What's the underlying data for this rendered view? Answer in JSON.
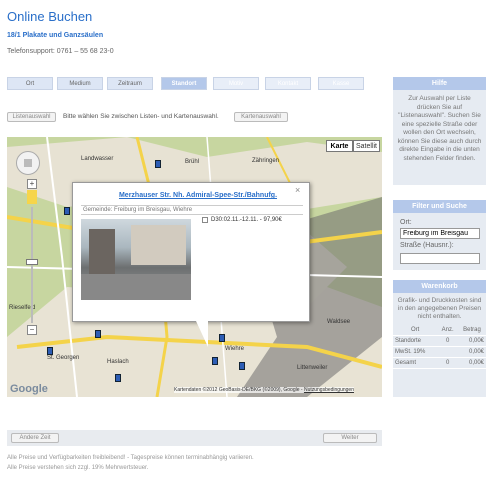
{
  "header": {
    "title": "Online Buchen",
    "subtitle": "18/1 Plakate und Ganzsäulen",
    "phone": "Telefonsupport: 0761 – 55 68 23-0"
  },
  "steps": [
    {
      "label": "Ort",
      "state": "normal"
    },
    {
      "label": "Medium",
      "state": "normal"
    },
    {
      "label": "Zeitraum",
      "state": "normal"
    },
    {
      "label": "Standort",
      "state": "active"
    },
    {
      "label": "Motiv",
      "state": "disabled"
    },
    {
      "label": "Kontakt",
      "state": "disabled"
    },
    {
      "label": "Kasse",
      "state": "disabled"
    }
  ],
  "toggle": {
    "list_button": "Listenauswahl",
    "description": "Bitte wählen Sie zwischen Listen- und Kartenauswahl.",
    "map_button": "Kartenauswahl"
  },
  "map": {
    "type_map": "Karte",
    "type_sat": "Satellit",
    "labels": [
      "Landwasser",
      "Brühl",
      "Zähringen",
      "Rieselfeld",
      "Haslach",
      "St. Georgen",
      "Wiehre",
      "Waldsee",
      "Littenweiler"
    ],
    "copyright": "Kartendaten ©2012 GeoBasis-DE/BKG (©2009), Google -",
    "terms": "Nutzungsbedingungen",
    "google": "Google"
  },
  "popup": {
    "title": "Merzhauser Str. Nh. Admiral-Spee-Str./Bahnufg.",
    "location": "Gemeinde: Freiburg im Breisgau, Wiehre",
    "offer": "D30:02.11.-12.11. - 97,90€",
    "close": "×"
  },
  "sidebar": {
    "help": {
      "title": "Hilfe",
      "text": "Zur Auswahl per Liste drücken Sie auf \"Listenauswahl\". Suchen Sie eine spezielle Straße oder wollen den Ort wechseln, können Sie diese auch durch direkte Eingabe in die unten stehenden Felder finden."
    },
    "filter": {
      "title": "Filter und Suche",
      "ort_label": "Ort:",
      "ort_value": "Freiburg im Breisgau",
      "street_label": "Straße (Hausnr.):",
      "street_value": ""
    },
    "cart": {
      "title": "Warenkorb",
      "text": "Grafik- und Druckkosten sind in den angegebenen Preisen nicht enthalten.",
      "headers": [
        "Ort",
        "Anz.",
        "Betrag"
      ],
      "rows": [
        {
          "label": "Standorte",
          "count": "0",
          "amount": "0,00€"
        },
        {
          "label": "MwSt. 19%",
          "count": "",
          "amount": "0,00€"
        },
        {
          "label": "Gesamt",
          "count": "0",
          "amount": "0,00€"
        }
      ]
    }
  },
  "nav": {
    "back": "Andere Zeit",
    "next": "Weiter"
  },
  "footer": {
    "line1": "Alle Preise und Verfügbarkeiten freibleibend! - Tagespreise können terminabhängig variieren.",
    "line2": "Alle Preise verstehen sich zzgl. 19% Mehrwertsteuer."
  }
}
